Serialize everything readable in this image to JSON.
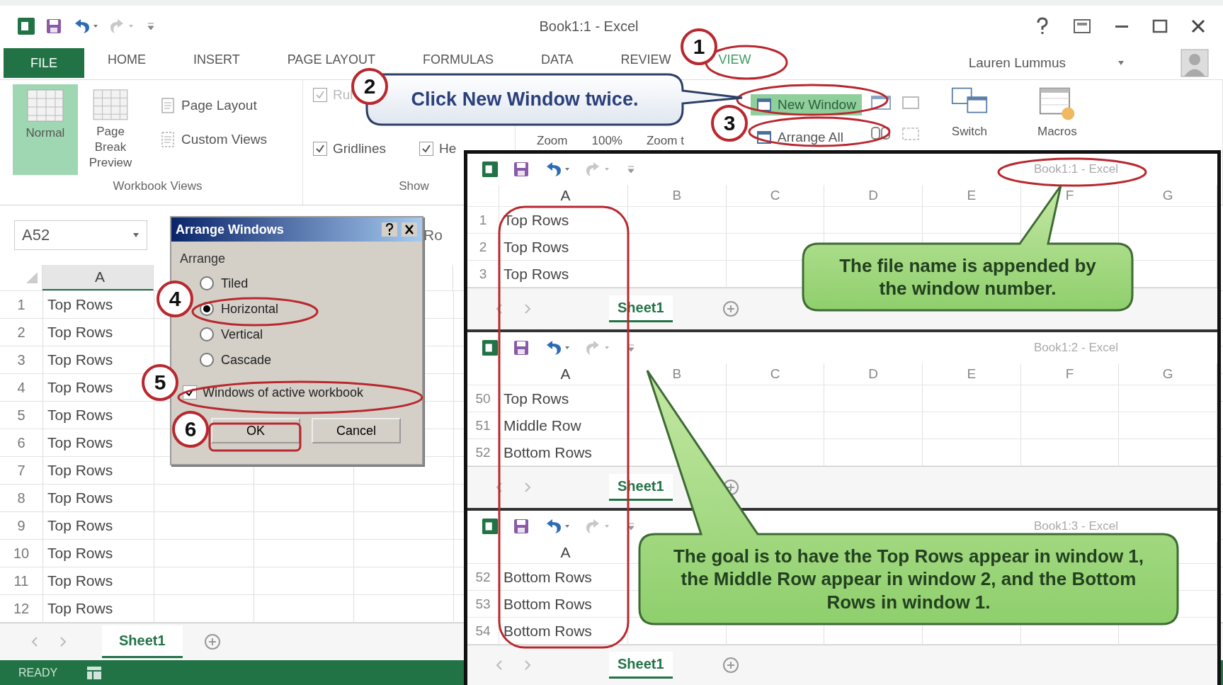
{
  "main_window": {
    "title": "Book1:1 - Excel",
    "user": "Lauren Lummus",
    "tabs": [
      {
        "label": "FILE",
        "kind": "file",
        "selected": false
      },
      {
        "label": "HOME",
        "kind": "tab",
        "selected": false
      },
      {
        "label": "INSERT",
        "kind": "tab",
        "selected": false
      },
      {
        "label": "PAGE LAYOUT",
        "kind": "tab",
        "selected": false
      },
      {
        "label": "FORMULAS",
        "kind": "tab",
        "selected": false
      },
      {
        "label": "DATA",
        "kind": "tab",
        "selected": false
      },
      {
        "label": "REVIEW",
        "kind": "tab",
        "selected": false
      },
      {
        "label": "VIEW",
        "kind": "tab",
        "selected": true
      }
    ],
    "ribbon": {
      "workbook_views": {
        "label": "Workbook Views",
        "large": [
          {
            "label": "Normal",
            "selected": true
          },
          {
            "label": "Page Break Preview",
            "selected": false
          }
        ],
        "small": [
          "Page Layout",
          "Custom Views"
        ]
      },
      "show": {
        "label": "Show",
        "items": [
          {
            "label": "Rul",
            "checked": true,
            "disabled": true
          },
          {
            "label": "Gridlines",
            "checked": true,
            "disabled": false
          },
          {
            "label": "He",
            "checked": true,
            "disabled": false
          }
        ]
      },
      "zoom": {
        "items": [
          "Zoom",
          "100%",
          "Zoom t"
        ]
      },
      "window": {
        "items": [
          {
            "label": "New Window",
            "active": true
          },
          {
            "label": "Arrange All",
            "active": false
          }
        ],
        "large": [
          "Switch",
          "Macros"
        ]
      }
    },
    "name_box": "A52",
    "formula": "Ro",
    "column": "A",
    "rows": [
      {
        "number": "1",
        "value": "Top Rows"
      },
      {
        "number": "2",
        "value": "Top Rows"
      },
      {
        "number": "3",
        "value": "Top Rows"
      },
      {
        "number": "4",
        "value": "Top Rows"
      },
      {
        "number": "5",
        "value": "Top Rows"
      },
      {
        "number": "6",
        "value": "Top Rows"
      },
      {
        "number": "7",
        "value": "Top Rows"
      },
      {
        "number": "8",
        "value": "Top Rows"
      },
      {
        "number": "9",
        "value": "Top Rows"
      },
      {
        "number": "10",
        "value": "Top Rows"
      },
      {
        "number": "11",
        "value": "Top Rows"
      },
      {
        "number": "12",
        "value": "Top Rows"
      }
    ],
    "sheet_tab": "Sheet1",
    "status": "READY"
  },
  "dialog": {
    "title": "Arrange Windows",
    "group": "Arrange",
    "options": [
      {
        "label": "Tiled",
        "selected": false
      },
      {
        "label": "Horizontal",
        "selected": true
      },
      {
        "label": "Vertical",
        "selected": false
      },
      {
        "label": "Cascade",
        "selected": false
      }
    ],
    "checkbox": {
      "label": "Windows of active workbook",
      "checked": true
    },
    "buttons": [
      "OK",
      "Cancel"
    ]
  },
  "windows": [
    {
      "title": "Book1:1 - Excel",
      "columns": [
        "A",
        "B",
        "C",
        "D",
        "E",
        "F",
        "G"
      ],
      "rows": [
        {
          "number": "1",
          "value": "Top Rows"
        },
        {
          "number": "2",
          "value": "Top Rows"
        },
        {
          "number": "3",
          "value": "Top Rows"
        }
      ],
      "sheet_tab": "Sheet1"
    },
    {
      "title": "Book1:2 - Excel",
      "columns": [
        "A",
        "B",
        "C",
        "D",
        "E",
        "F",
        "G"
      ],
      "rows": [
        {
          "number": "50",
          "value": "Top Rows"
        },
        {
          "number": "51",
          "value": "Middle Row"
        },
        {
          "number": "52",
          "value": "Bottom Rows"
        }
      ],
      "sheet_tab": "Sheet1"
    },
    {
      "title": "Book1:3 - Excel",
      "columns": [
        "A"
      ],
      "rows": [
        {
          "number": "52",
          "value": "Bottom Rows"
        },
        {
          "number": "53",
          "value": "Bottom Rows"
        },
        {
          "number": "54",
          "value": "Bottom Rows"
        }
      ],
      "sheet_tab": "Sheet1"
    }
  ],
  "steps": [
    "1",
    "2",
    "3",
    "4",
    "5",
    "6"
  ],
  "callouts": [
    {
      "text": "Click New Window twice.",
      "kind": "blue"
    },
    {
      "text": "The file name is appended by the window number.",
      "kind": "green"
    },
    {
      "text": "The goal is to have the Top Rows appear in window 1, the Middle Row appear in window 2, and the Bottom Rows in window 1.",
      "kind": "green"
    }
  ]
}
